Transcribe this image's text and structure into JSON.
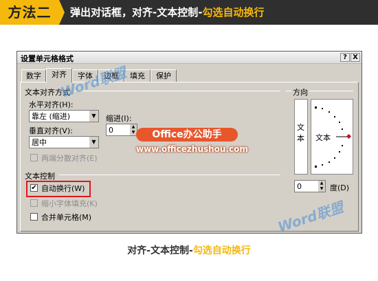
{
  "banner": {
    "badge": "方法二",
    "text_prefix": "弹出对话框，对齐-文本控制-",
    "text_highlight": "勾选自动换行"
  },
  "dialog": {
    "title": "设置单元格格式",
    "help_btn": "?",
    "close_btn": "X",
    "tabs": [
      "数字",
      "对齐",
      "字体",
      "边框",
      "填充",
      "保护"
    ],
    "active_tab": "对齐",
    "alignment": {
      "section": "文本对齐方式",
      "horizontal_label": "水平对齐(H):",
      "horizontal_value": "靠左 (缩进)",
      "indent_label": "缩进(I):",
      "indent_value": "0",
      "vertical_label": "垂直对齐(V):",
      "vertical_value": "居中",
      "distributed": "两端分散对齐(E)"
    },
    "text_control": {
      "section": "文本控制",
      "wrap_text": "自动换行(W)",
      "wrap_checked": "✔",
      "shrink": "缩小字体填充(K)",
      "merge": "合并单元格(M)"
    },
    "orientation": {
      "section": "方向",
      "vertical_text": [
        "文",
        "本"
      ],
      "dial_text": "文本",
      "degree_value": "0",
      "degree_label": "度(D)"
    }
  },
  "watermark": {
    "brand": "Office办公助手",
    "url": "www.officezhushou.com",
    "word": "Word联盟"
  },
  "caption": {
    "prefix": "对齐-文本控制-",
    "highlight": "勾选自动换行"
  }
}
